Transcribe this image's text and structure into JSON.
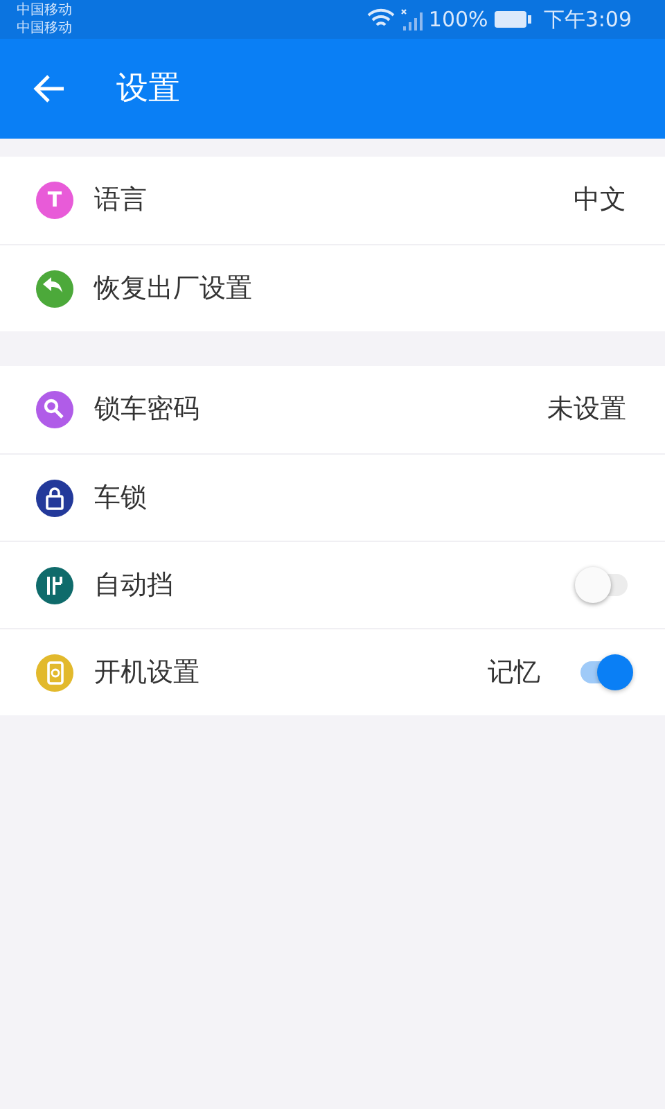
{
  "status_bar": {
    "carriers": [
      "中国移动",
      "中国移动"
    ],
    "battery_text": "100%",
    "time": "下午3:09"
  },
  "app_bar": {
    "title": "设置"
  },
  "sections": [
    {
      "items": [
        {
          "kind": "value",
          "icon_text": "T",
          "color": "#e85bd8",
          "label": "语言",
          "value": "中文"
        },
        {
          "kind": "plain",
          "color": "#4ca93a",
          "label": "恢复出厂设置"
        }
      ]
    },
    {
      "items": [
        {
          "kind": "value",
          "color": "#b05ce8",
          "label": "锁车密码",
          "value": "未设置"
        },
        {
          "kind": "plain",
          "color": "#23399a",
          "label": "车锁"
        },
        {
          "kind": "switch",
          "color": "#0f6b6b",
          "label": "自动挡",
          "on": false
        },
        {
          "kind": "switch",
          "color": "#e2b92c",
          "label": "开机设置",
          "value": "记忆",
          "on": true
        }
      ]
    }
  ]
}
